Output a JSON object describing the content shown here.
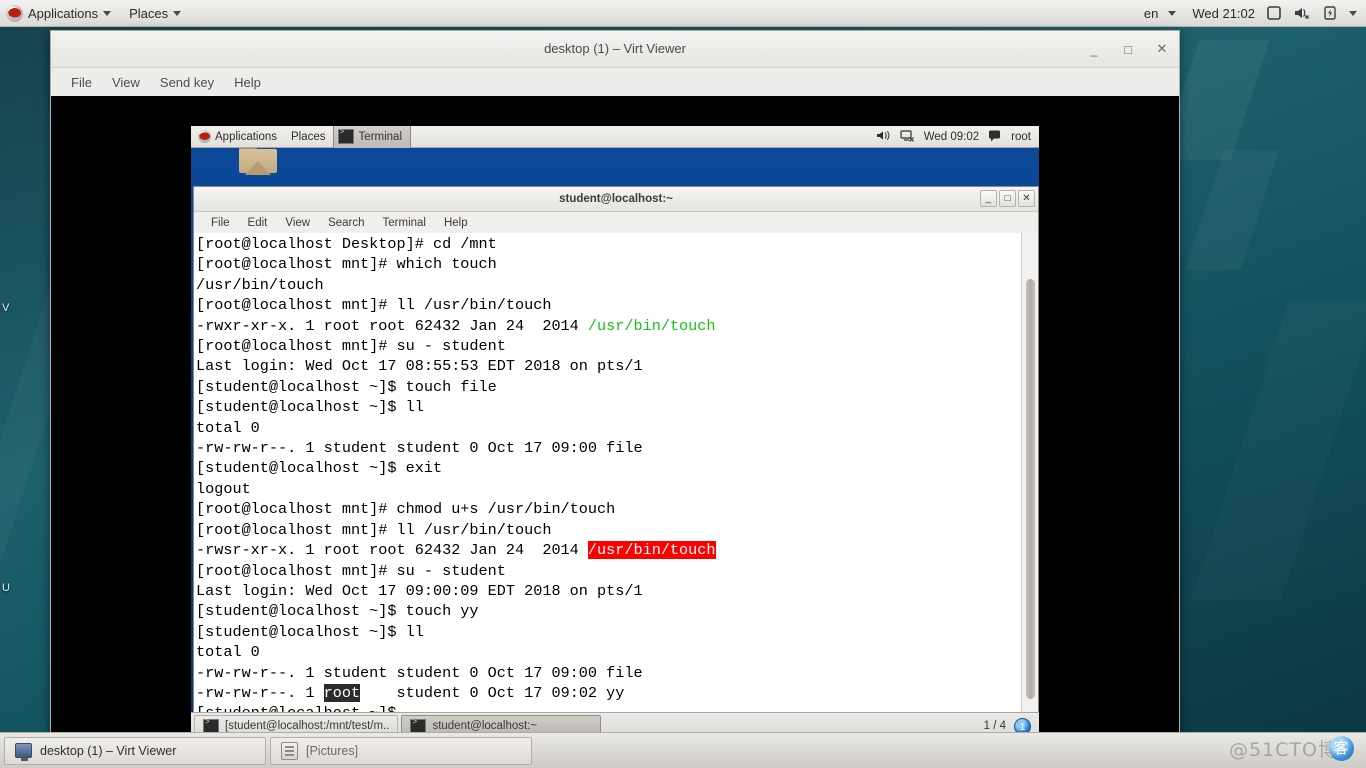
{
  "host_panel": {
    "applications_label": "Applications",
    "places_label": "Places",
    "language": "en",
    "clock": "Wed 21:02",
    "icons": [
      "display-icon",
      "volume-muted-icon",
      "battery-icon",
      "chevron-down-icon"
    ]
  },
  "desktop_icon_labels": [
    "V",
    "U"
  ],
  "virt_viewer": {
    "title": "desktop (1) – Virt Viewer",
    "window_buttons": {
      "minimize": "_",
      "maximize": "□",
      "close": "✕"
    },
    "menu": [
      "File",
      "View",
      "Send key",
      "Help"
    ]
  },
  "vm_panel": {
    "applications_label": "Applications",
    "places_label": "Places",
    "active_task": "Terminal",
    "clock": "Wed 09:02",
    "user": "root"
  },
  "terminal": {
    "title": "student@localhost:~",
    "menu": [
      "File",
      "Edit",
      "View",
      "Search",
      "Terminal",
      "Help"
    ],
    "window_buttons": {
      "minimize": "_",
      "maximize": "□",
      "close": "✕"
    },
    "colors": {
      "green": "#16c316",
      "red_highlight": "#fd0000",
      "inverse_highlight": "#2b2b2b"
    },
    "lines": [
      [
        {
          "t": "[root@localhost Desktop]# cd /mnt"
        }
      ],
      [
        {
          "t": "[root@localhost mnt]# which touch"
        }
      ],
      [
        {
          "t": "/usr/bin/touch"
        }
      ],
      [
        {
          "t": "[root@localhost mnt]# ll /usr/bin/touch"
        }
      ],
      [
        {
          "t": "-rwxr-xr-x. 1 root root 62432 Jan 24  2014 "
        },
        {
          "t": "/usr/bin/touch",
          "c": "g"
        }
      ],
      [
        {
          "t": "[root@localhost mnt]# su - student"
        }
      ],
      [
        {
          "t": "Last login: Wed Oct 17 08:55:53 EDT 2018 on pts/1"
        }
      ],
      [
        {
          "t": "[student@localhost ~]$ touch file"
        }
      ],
      [
        {
          "t": "[student@localhost ~]$ ll"
        }
      ],
      [
        {
          "t": "total 0"
        }
      ],
      [
        {
          "t": "-rw-rw-r--. 1 student student 0 Oct 17 09:00 file"
        }
      ],
      [
        {
          "t": "[student@localhost ~]$ exit"
        }
      ],
      [
        {
          "t": "logout"
        }
      ],
      [
        {
          "t": "[root@localhost mnt]# chmod u+s /usr/bin/touch"
        }
      ],
      [
        {
          "t": "[root@localhost mnt]# ll /usr/bin/touch"
        }
      ],
      [
        {
          "t": "-rwsr-xr-x. 1 root root 62432 Jan 24  2014 "
        },
        {
          "t": "/usr/bin/touch",
          "c": "redhl"
        }
      ],
      [
        {
          "t": "[root@localhost mnt]# su - student"
        }
      ],
      [
        {
          "t": "Last login: Wed Oct 17 09:00:09 EDT 2018 on pts/1"
        }
      ],
      [
        {
          "t": "[student@localhost ~]$ touch yy"
        }
      ],
      [
        {
          "t": "[student@localhost ~]$ ll"
        }
      ],
      [
        {
          "t": "total 0"
        }
      ],
      [
        {
          "t": "-rw-rw-r--. 1 student student 0 Oct 17 09:00 file"
        }
      ],
      [
        {
          "t": "-rw-rw-r--. 1 "
        },
        {
          "t": "root",
          "c": "invhl"
        },
        {
          "t": "    student 0 Oct 17 09:02 yy"
        }
      ],
      [
        {
          "t": "[student@localhost ~]$"
        }
      ]
    ]
  },
  "vm_taskbar": {
    "tasks": [
      {
        "label": "[student@localhost:/mnt/test/m..",
        "active": false
      },
      {
        "label": "student@localhost:~",
        "active": true
      }
    ],
    "workspace_indicator": "1 / 4",
    "workspace_badge": "1"
  },
  "host_taskbar": {
    "tasks": [
      {
        "label": "desktop (1) – Virt Viewer",
        "icon": "monitor-icon",
        "active": true
      },
      {
        "label": "[Pictures]",
        "icon": "pictures-icon",
        "active": false
      }
    ]
  },
  "watermark": {
    "text": "@51CTO博",
    "circle": "客"
  }
}
